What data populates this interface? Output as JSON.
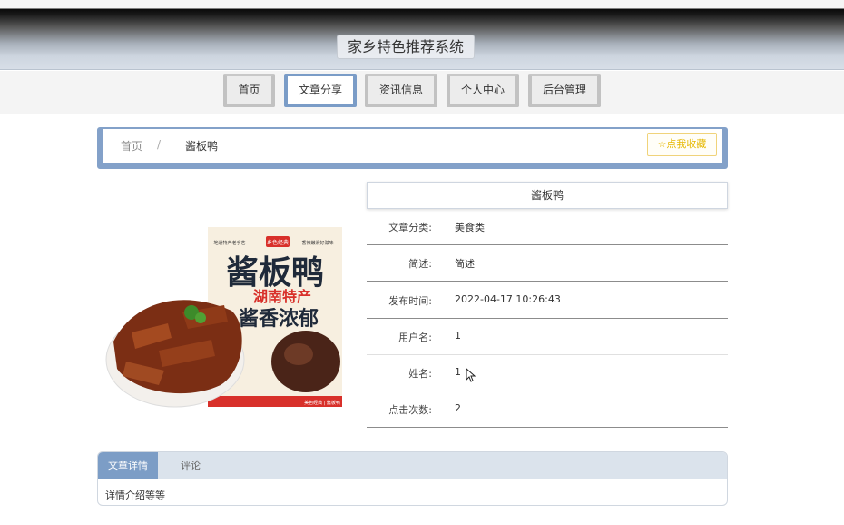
{
  "header": {
    "title": "家乡特色推荐系统"
  },
  "nav": {
    "items": [
      {
        "label": "首页"
      },
      {
        "label": "文章分享"
      },
      {
        "label": "资讯信息"
      },
      {
        "label": "个人中心"
      },
      {
        "label": "后台管理"
      }
    ],
    "active": "文章分享"
  },
  "breadcrumb": {
    "home": "首页",
    "separator": "/",
    "current": "酱板鸭"
  },
  "favorite_button": "☆点我收藏",
  "product_image": {
    "package_title": "酱板鸭",
    "package_subtitle": "湖南特产",
    "package_slogan": "酱香浓郁",
    "package_brand": "乡色经典",
    "package_tag_left": "地道特产老手艺",
    "package_tag_right": "香辣嫩滑好滋味",
    "package_footer": "美色经典 | 酱板鸭"
  },
  "detail": {
    "title": "酱板鸭",
    "rows": [
      {
        "label": "文章分类:",
        "value": "美食类"
      },
      {
        "label": "简述:",
        "value": "简述"
      },
      {
        "label": "发布时间:",
        "value": "2022-04-17 10:26:43"
      },
      {
        "label": "用户名:",
        "value": "1"
      },
      {
        "label": "姓名:",
        "value": "1"
      },
      {
        "label": "点击次数:",
        "value": "2"
      }
    ]
  },
  "tabs": {
    "items": [
      {
        "label": "文章详情"
      },
      {
        "label": "评论"
      }
    ],
    "active": "文章详情",
    "content": "详情介绍等等"
  },
  "colors": {
    "accent": "#7c9dc6",
    "favorite": "#e6b800",
    "header_dark": "#0a0a0a"
  }
}
